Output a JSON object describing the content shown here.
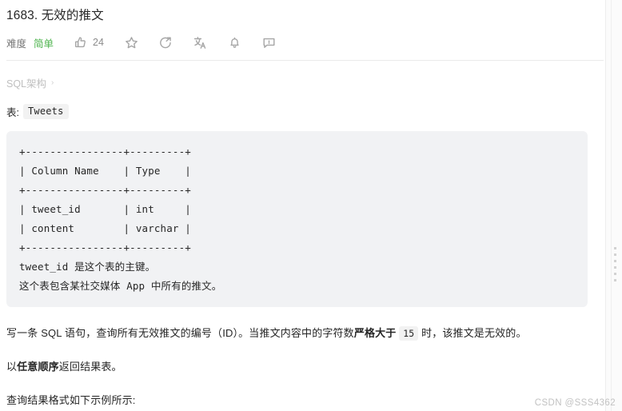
{
  "problem": {
    "title": "1683. 无效的推文"
  },
  "meta": {
    "difficulty_label": "难度",
    "difficulty_value": "简单",
    "difficulty_color": "#4db34d",
    "like_count": "24",
    "icons": {
      "thumbs_up": "thumbs-up-icon",
      "star": "star-icon",
      "share": "share-icon",
      "translate": "translate-icon",
      "bell": "bell-icon",
      "comment": "comment-icon"
    }
  },
  "breadcrumb": {
    "label": "SQL架构",
    "chevron": "›"
  },
  "table_intro": {
    "prefix": "表:",
    "table_name": "Tweets"
  },
  "schema_block": {
    "lines": [
      "+----------------+---------+",
      "| Column Name    | Type    |",
      "+----------------+---------+",
      "| tweet_id       | int     |",
      "| content        | varchar |",
      "+----------------+---------+"
    ],
    "note_line_1_code": "tweet_id",
    "note_line_1_text": " 是这个表的主键。",
    "note_line_2_a": "这个表包含某社交媒体 ",
    "note_line_2_code": "App",
    "note_line_2_b": " 中所有的推文。"
  },
  "body": {
    "p1_a": "写一条 SQL 语句，查询所有无效推文的编号（ID）。当推文内容中的字符数",
    "p1_bold": "严格大于",
    "p1_code": "15",
    "p1_b": "时，该推文是无效的。",
    "p2_a": "以",
    "p2_bold": "任意顺序",
    "p2_b": "返回结果表。",
    "p3": "查询结果格式如下示例所示:"
  },
  "watermark": {
    "text": "CSDN @SSS4362"
  }
}
